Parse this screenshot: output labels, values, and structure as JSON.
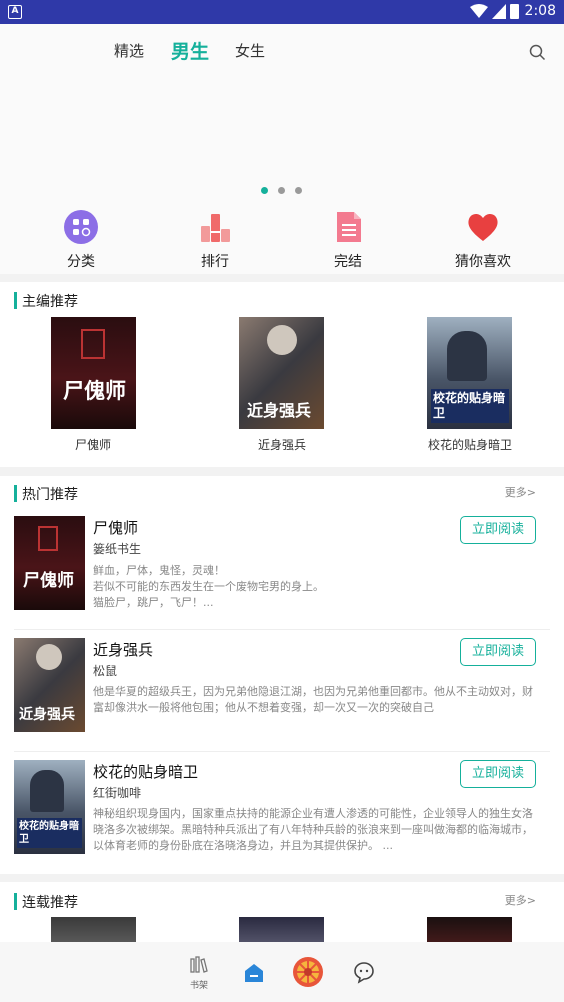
{
  "status_bar": {
    "time": "2:08",
    "left_icon_letter": "A"
  },
  "top_tabs": [
    "精选",
    "男生",
    "女生"
  ],
  "banner": {
    "dots": 3,
    "active_dot": 0
  },
  "categories": [
    {
      "label": "分类",
      "icon": "grid-icon",
      "color": "#8c6ee6"
    },
    {
      "label": "排行",
      "icon": "bar-chart-icon",
      "color": "#f06a6a"
    },
    {
      "label": "完结",
      "icon": "document-icon",
      "color": "#f37a8f"
    },
    {
      "label": "猜你喜欢",
      "icon": "heart-icon",
      "color": "#e84040"
    }
  ],
  "editor_picks": {
    "title": "主编推荐",
    "books": [
      {
        "title": "尸傀师",
        "cover_text": "尸傀师"
      },
      {
        "title": "近身强兵",
        "cover_text": "近身强兵"
      },
      {
        "title": "校花的贴身暗卫",
        "cover_text": "校花的贴身暗卫"
      }
    ]
  },
  "hot": {
    "title": "热门推荐",
    "more": "更多>",
    "read_label": "立即阅读",
    "items": [
      {
        "title": "尸傀师",
        "author": "篓纸书生",
        "desc": "鲜血，尸体，鬼怪，灵魂！\n若似不可能的东西发生在一个废物宅男的身上。\n猫脸尸，跳尸，飞尸！..."
      },
      {
        "title": "近身强兵",
        "author": "松鼠",
        "desc": "他是华夏的超级兵王，因为兄弟他隐退江湖，也因为兄弟他重回都市。他从不主动奴对，财富却像洪水一般将他包围；他从不想着变强，却一次又一次的突破自己"
      },
      {
        "title": "校花的贴身暗卫",
        "author": "红街咖啡",
        "desc": "神秘组织现身国内，国家重点扶持的能源企业有遭人渗透的可能性，企业领导人的独生女洛晓洛多次被绑架。黑暗特种兵派出了有八年特种兵龄的张浪来到一座叫做海都的临海城市，以体育老师的身份卧底在洛晓洛身边，并且为其提供保护。 ..."
      }
    ]
  },
  "serial": {
    "title": "连载推荐",
    "more": "更多>"
  },
  "bottom_nav": [
    {
      "label": "书架",
      "icon": "bookshelf-icon"
    },
    {
      "label": "",
      "icon": "home-icon"
    },
    {
      "label": "",
      "icon": "lucky-wheel-icon"
    },
    {
      "label": "",
      "icon": "chat-bubble-icon"
    }
  ],
  "colors": {
    "accent": "#15b09b",
    "status_bar": "#2f39a8"
  }
}
